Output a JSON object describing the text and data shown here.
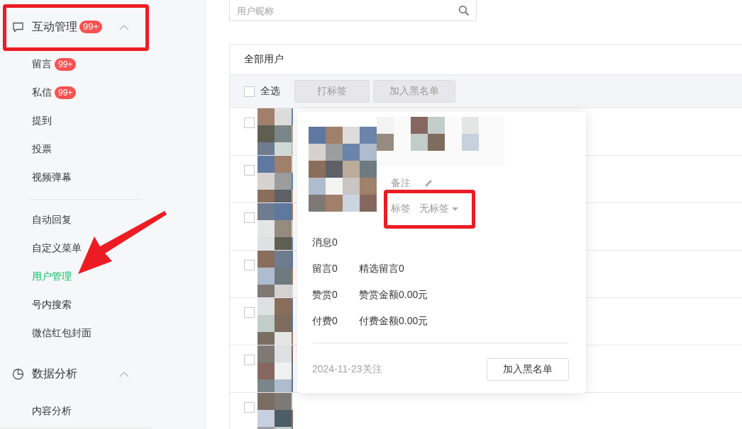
{
  "sidebar": {
    "groups": [
      {
        "title": "互动管理",
        "badge": "99+",
        "expanded": true,
        "highlighted": true,
        "sections": [
          {
            "items": [
              {
                "label": "留言",
                "badge": "99+",
                "selected": false
              },
              {
                "label": "私信",
                "badge": "99+",
                "selected": false
              },
              {
                "label": "提到",
                "selected": false
              },
              {
                "label": "投票",
                "selected": false
              },
              {
                "label": "视频弹幕",
                "selected": false
              }
            ]
          },
          {
            "items": [
              {
                "label": "自动回复",
                "selected": false
              },
              {
                "label": "自定义菜单",
                "selected": false
              },
              {
                "label": "用户管理",
                "selected": true
              },
              {
                "label": "号内搜索",
                "selected": false
              },
              {
                "label": "微信红包封面",
                "selected": false
              }
            ]
          }
        ]
      },
      {
        "title": "数据分析",
        "expanded": true,
        "highlighted": false,
        "sections": [
          {
            "items": [
              {
                "label": "内容分析",
                "selected": false
              }
            ]
          }
        ]
      }
    ]
  },
  "annotation": {
    "arrow": true
  },
  "search": {
    "placeholder": "用户昵称"
  },
  "user_list": {
    "title": "全部用户",
    "select_all": {
      "label": "全选",
      "checked": false
    },
    "actions": [
      {
        "label": "打标签",
        "disabled": true
      },
      {
        "label": "加入黑名单",
        "disabled": true
      }
    ],
    "rows": [
      {
        "checked": false
      },
      {
        "checked": false
      },
      {
        "checked": false
      },
      {
        "checked": false
      },
      {
        "checked": false
      },
      {
        "checked": false
      },
      {
        "checked": false
      }
    ]
  },
  "popup": {
    "remark_label": "备注",
    "tag_label": "标签",
    "tag_value": "无标签",
    "tag_highlighted": true,
    "stats": [
      [
        "消息0"
      ],
      [
        "留言0",
        "精选留言0"
      ],
      [
        "赞赏0",
        "赞赏金额0.00元"
      ],
      [
        "付费0",
        "付费金额0.00元"
      ]
    ],
    "followed": "2024-11-23关注",
    "button": "加入黑名单"
  }
}
